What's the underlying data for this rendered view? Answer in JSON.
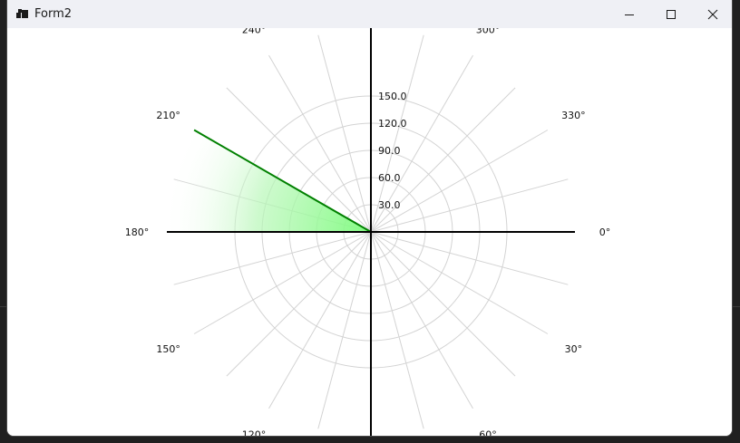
{
  "window": {
    "title": "Form2",
    "controls": {
      "minimize_icon": "minimize-icon",
      "maximize_icon": "maximize-icon",
      "close_icon": "close-icon"
    }
  },
  "chart_data": {
    "type": "polar",
    "radial_axis": {
      "ticks": [
        30,
        60,
        90,
        120,
        150
      ],
      "tick_labels": [
        "30.0",
        "60.0",
        "90.0",
        "120.0",
        "150.0"
      ]
    },
    "angular_axis": {
      "unit": "degrees",
      "direction": "clockwise",
      "zero_position": "right",
      "labels": [
        {
          "angle": 0,
          "text": "0°"
        },
        {
          "angle": 30,
          "text": "30°"
        },
        {
          "angle": 60,
          "text": "60°"
        },
        {
          "angle": 120,
          "text": "120°"
        },
        {
          "angle": 150,
          "text": "150°"
        },
        {
          "angle": 180,
          "text": "180°"
        },
        {
          "angle": 210,
          "text": "210°"
        },
        {
          "angle": 240,
          "text": "240°"
        },
        {
          "angle": 300,
          "text": "300°"
        },
        {
          "angle": 330,
          "text": "330°"
        }
      ],
      "gridline_step": 15
    },
    "sector": {
      "start_angle": 180,
      "end_angle": 210,
      "edge_color": "#008000",
      "fill_color": "#90ee90"
    },
    "axis_lines": {
      "color": "#000000",
      "angles": [
        0,
        90,
        180,
        270
      ]
    },
    "grid": true,
    "grid_color": "#d3d3d3"
  }
}
